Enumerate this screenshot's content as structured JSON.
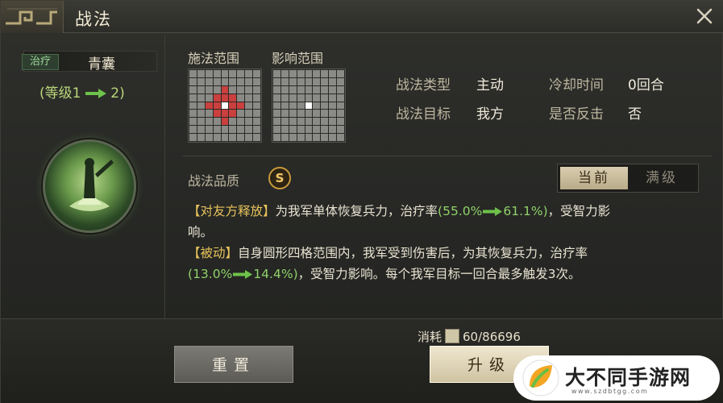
{
  "header": {
    "title": "战法"
  },
  "skill": {
    "type_tag": "治疗",
    "name": "青囊",
    "level_prefix": "(等级1",
    "level_suffix": "2)"
  },
  "ranges": {
    "cast_label": "施法范围",
    "effect_label": "影响范围",
    "cast_grid_red": [
      [
        3,
        4
      ],
      [
        4,
        3
      ],
      [
        4,
        5
      ],
      [
        5,
        4
      ],
      [
        2,
        4
      ],
      [
        4,
        2
      ],
      [
        4,
        6
      ],
      [
        6,
        4
      ],
      [
        3,
        3
      ],
      [
        3,
        5
      ],
      [
        5,
        3
      ],
      [
        5,
        5
      ]
    ],
    "cast_grid_white": [
      [
        4,
        4
      ]
    ],
    "effect_grid_white": [
      [
        4,
        4
      ]
    ]
  },
  "info": {
    "type_label": "战法类型",
    "type_value": "主动",
    "target_label": "战法目标",
    "target_value": "我方",
    "cooldown_label": "冷却时间",
    "cooldown_value": "0回合",
    "counter_label": "是否反击",
    "counter_value": "否"
  },
  "quality": {
    "label": "战法品质",
    "grade": "S"
  },
  "toggle": {
    "current": "当前",
    "max": "满级"
  },
  "description": {
    "line1_tag": "【对友方释放】",
    "line1_text": "为我军单体恢复兵力，治疗率",
    "line1_open": "(",
    "line1_from": "55.0%",
    "line1_to": "61.1%",
    "line1_close": ")",
    "line1_tail": "，受智力影",
    "line2": "响。",
    "line3_tag": "【被动】",
    "line3_text": "自身圆形四格范围内，我军受到伤害后，为其恢复兵力，治疗率",
    "line4_open": "(",
    "line4_from": "13.0%",
    "line4_to": "14.4%",
    "line4_close": ")",
    "line4_tail": "，受智力影响。每个我军目标一回合最多触发3次。"
  },
  "footer": {
    "cost_label": "消耗",
    "cost_value": "60/86696",
    "reset_label": "重置",
    "upgrade_label": "升级"
  },
  "watermark": {
    "text": "大不同手游网",
    "url": "www.szdbtgg.com"
  },
  "colors": {
    "accent_green": "#8fd16a",
    "gold": "#e8c35c",
    "heal_red": "#c9403f"
  }
}
